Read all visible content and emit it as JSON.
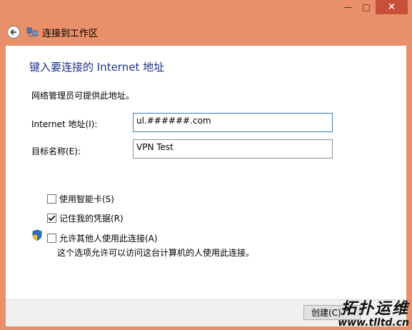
{
  "window": {
    "title": "连接到工作区",
    "controls": {
      "minimize": "—",
      "maximize": "□",
      "close": "✕"
    }
  },
  "page": {
    "heading": "键入要连接的 Internet 地址",
    "description": "网络管理员可提供此地址。"
  },
  "form": {
    "address_label": "Internet 地址(I):",
    "address_value": "ul.######.com",
    "name_label": "目标名称(E):",
    "name_value": "VPN Test"
  },
  "options": [
    {
      "label": "使用智能卡(S)",
      "checked": false
    },
    {
      "label": "记住我的凭据(R)",
      "checked": true
    },
    {
      "label": "允许其他人使用此连接(A)",
      "checked": false
    }
  ],
  "note": "这个选项允许可以访问这台计算机的人使用此连接。",
  "footer": {
    "create_label": "创建(C)"
  },
  "watermark": {
    "logo": "拓扑运维",
    "url": "www.tlltd.cn"
  },
  "colors": {
    "frame": "#e9906a",
    "heading": "#1e3287",
    "close": "#c7503a"
  }
}
